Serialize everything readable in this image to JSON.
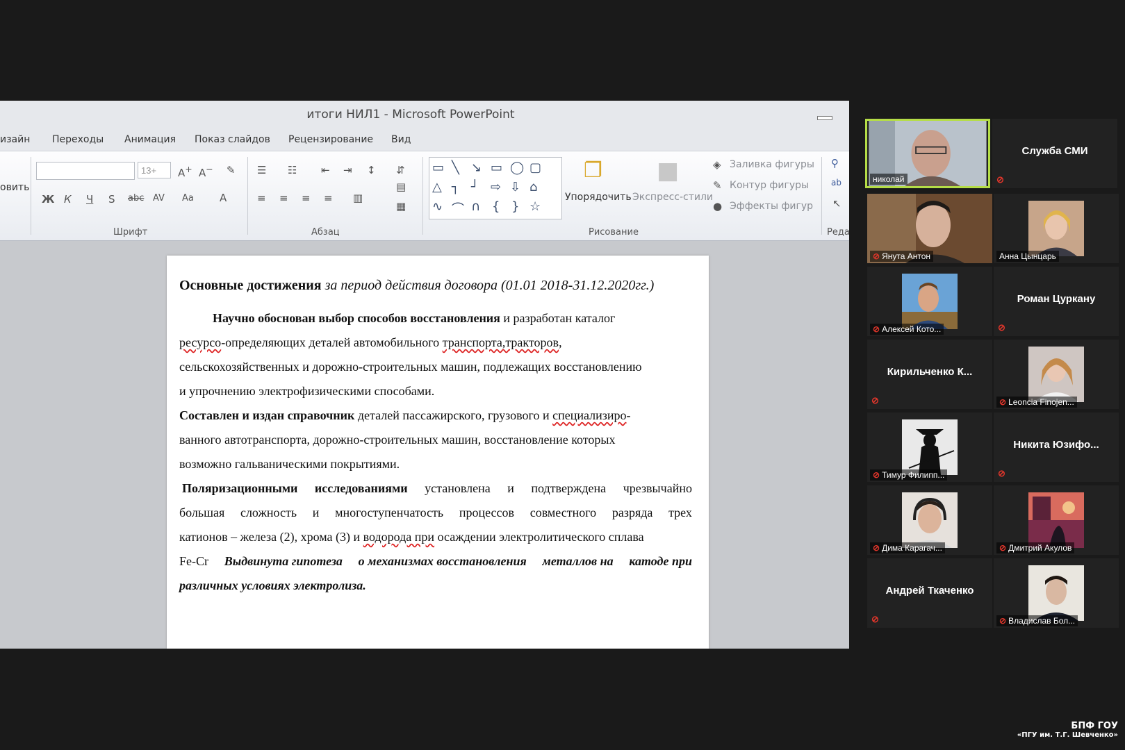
{
  "window": {
    "title": "итоги НИЛ1 - Microsoft PowerPoint"
  },
  "tabs": [
    "изайн",
    "Переходы",
    "Анимация",
    "Показ слайдов",
    "Рецензирование",
    "Вид"
  ],
  "ribbon": {
    "clipboard_partial": "овить",
    "font_size": "13+",
    "group_font": "Шрифт",
    "group_paragraph": "Абзац",
    "group_drawing": "Рисование",
    "group_edit_partial": "Реда",
    "arrange": "Упорядочить",
    "quick_styles": "Экспресс-стили",
    "shape_fill": "Заливка фигуры",
    "shape_outline": "Контур фигуры",
    "shape_effects": "Эффекты фигур"
  },
  "slide": {
    "heading_bold": "Основные достижения",
    "heading_italic": "за период действия договора (01.01 2018-31.12.2020гг.)",
    "p1_bold": "Научно обоснован выбор способов восстановления",
    "p1_rest": " и разработан каталог",
    "p1_l2a": "ресурсо",
    "p1_l2b": "-определяющих деталей автомобильного ",
    "p1_l2c": "транспорта,тракторов",
    "p1_l2d": ",",
    "p1_l3": "сельскохозяйственных и дорожно-строительных машин, подлежащих восстановлению",
    "p1_l4": "и упрочнению электрофизическими способами.",
    "p2_bold": "Составлен и издан справочник",
    "p2_rest": " деталей пассажирского, грузового и ",
    "p2_u": "специализиро",
    "p2_end": "-",
    "p2_l2": "ванного автотранспорта, дорожно-строительных машин, восстановление которых",
    "p2_l3": "возможно гальваническими покрытиями.",
    "p3_l1": [
      "Поляризационными",
      "исследованиями",
      "установлена",
      "и",
      "подтверждена",
      "чрезвычайно"
    ],
    "p3_l2": [
      "большая",
      "сложность",
      "и",
      "многоступенчатость",
      "процессов",
      "совместного",
      "разряда",
      "трех"
    ],
    "p3_l3a": "катионов – железа (2), хрома (3) и ",
    "p3_l3b": "водорода при",
    "p3_l3c": " осаждении электролитического сплава",
    "p3_l4a": "Fe-Cr ",
    "p3_l4b": [
      "Выдвинута гипотеза",
      "о механизмах восстановления",
      "металлов на",
      "катоде при"
    ],
    "p3_l5": "различных условиях электролиза."
  },
  "participants": [
    {
      "name": "николай",
      "video": true,
      "active": true
    },
    {
      "name": "Служба СМИ",
      "video": false
    },
    {
      "name": "Янута Антон",
      "video": true
    },
    {
      "name": "Анна Цынцарь",
      "video": true
    },
    {
      "name": "Алексей Кото...",
      "video": true
    },
    {
      "name": "Роман Цуркану",
      "video": false
    },
    {
      "name": "Кирильченко К...",
      "video": false
    },
    {
      "name": "Leoncia Finojen...",
      "video": true
    },
    {
      "name": "Тимур Филипп...",
      "video": true
    },
    {
      "name": "Никита Юзифо...",
      "video": false
    },
    {
      "name": "Дима Карагач...",
      "video": true
    },
    {
      "name": "Дмитрий Акулов",
      "video": true
    },
    {
      "name": "Андрей Ткаченко",
      "video": false
    },
    {
      "name": "Владислав Бол...",
      "video": true
    }
  ],
  "watermark": {
    "line1": "БПФ ГОУ",
    "line2": "«ПГУ им. Т.Г. Шевченко»"
  },
  "colors": {
    "active_speaker": "#b5dd47",
    "muted": "#e2362b"
  }
}
